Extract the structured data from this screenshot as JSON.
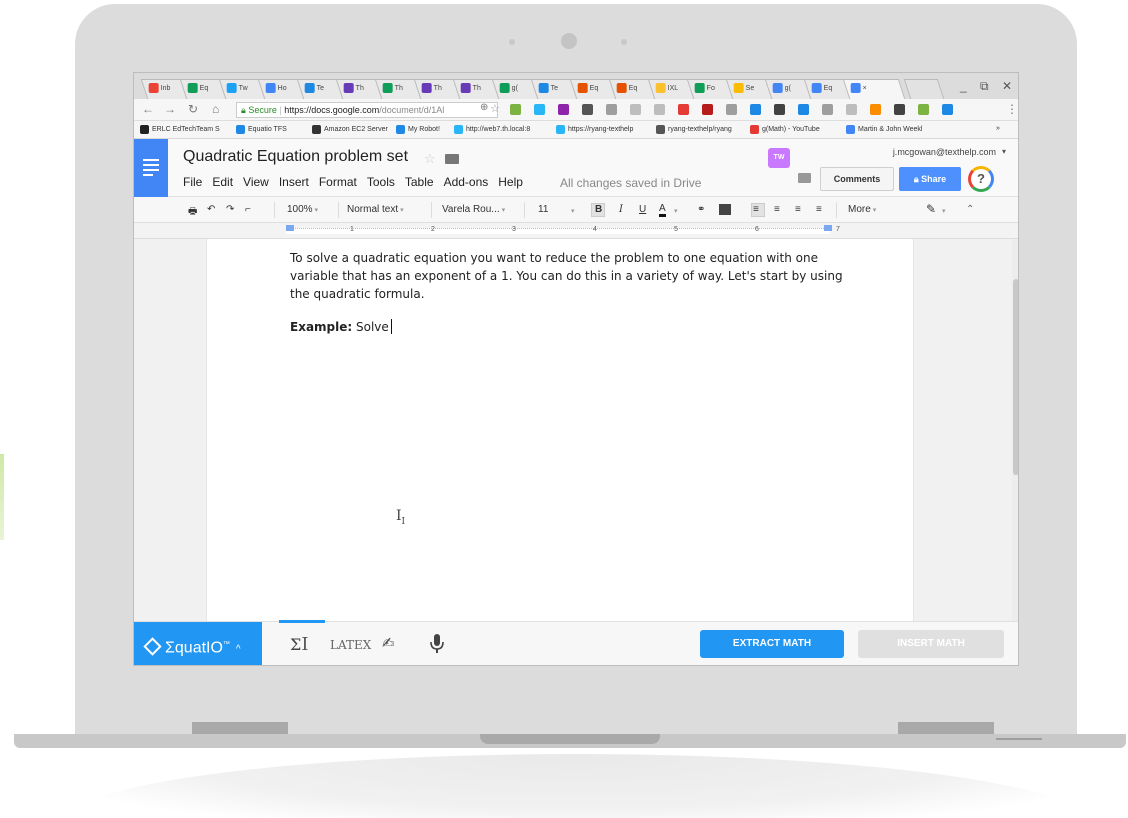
{
  "browser": {
    "tabs": [
      {
        "label": "Inb",
        "icon": "gmail-icon",
        "color": "#ea4335"
      },
      {
        "label": "Eq",
        "icon": "sheets-icon",
        "color": "#0f9d58"
      },
      {
        "label": "Tw",
        "icon": "twitter-icon",
        "color": "#1da1f2"
      },
      {
        "label": "Ho",
        "icon": "search-icon",
        "color": "#4285f4"
      },
      {
        "label": "Te",
        "icon": "tfs-icon",
        "color": "#1e88e5"
      },
      {
        "label": "Th",
        "icon": "forms-icon",
        "color": "#673ab7"
      },
      {
        "label": "Th",
        "icon": "sheets-icon",
        "color": "#0f9d58"
      },
      {
        "label": "Th",
        "icon": "forms-icon",
        "color": "#673ab7"
      },
      {
        "label": "Th",
        "icon": "forms-icon",
        "color": "#673ab7"
      },
      {
        "label": "g(",
        "icon": "sheets-icon",
        "color": "#0f9d58"
      },
      {
        "label": "Te",
        "icon": "tfs-icon",
        "color": "#1e88e5"
      },
      {
        "label": "Eq",
        "icon": "equatio-icon",
        "color": "#e65100"
      },
      {
        "label": "Eq",
        "icon": "equatio-icon",
        "color": "#e65100"
      },
      {
        "label": "IXL",
        "icon": "ixl-icon",
        "color": "#fbc02d"
      },
      {
        "label": "Fo",
        "icon": "sheets-icon",
        "color": "#0f9d58"
      },
      {
        "label": "Se",
        "icon": "drive-icon",
        "color": "#fbbc05"
      },
      {
        "label": "g(",
        "icon": "docs-icon",
        "color": "#4285f4"
      },
      {
        "label": "Eq",
        "icon": "docs-icon",
        "color": "#4285f4"
      },
      {
        "label": "×",
        "icon": "docs-icon",
        "color": "#4285f4"
      }
    ],
    "url_secure": "Secure",
    "url_host": "https://docs.google.com",
    "url_path": "/document/d/1Al",
    "bookmarks": [
      {
        "label": "ERLC EdTechTeam S",
        "color": "#222222"
      },
      {
        "label": "Equatio TFS",
        "color": "#1e88e5"
      },
      {
        "label": "Amazon EC2 Server",
        "color": "#333333"
      },
      {
        "label": "My Robot!",
        "color": "#1e88e5"
      },
      {
        "label": "http://web7.th.local:8",
        "color": "#29b6f6"
      },
      {
        "label": "https://ryang-texthelp",
        "color": "#29b6f6"
      },
      {
        "label": "ryang-texthelp/ryang",
        "color": "#555555"
      },
      {
        "label": "g(Math) - YouTube",
        "color": "#e53935"
      },
      {
        "label": "Martin & John Weekl",
        "color": "#4285f4"
      },
      {
        "label": "»",
        "color": "#ffffff"
      }
    ]
  },
  "docs": {
    "title": "Quadratic Equation problem set",
    "menu": [
      "File",
      "Edit",
      "View",
      "Insert",
      "Format",
      "Tools",
      "Table",
      "Add-ons",
      "Help"
    ],
    "saved_status": "All changes saved in Drive",
    "user_email": "j.mcgowan@texthelp.com",
    "comments_label": "Comments",
    "share_label": "Share",
    "extension_badge": "TW",
    "toolbar": {
      "zoom": "100%",
      "style": "Normal text",
      "font": "Varela Rou...",
      "size": "11",
      "bold": "B",
      "italic": "I",
      "underline": "U",
      "text_color": "A",
      "more": "More"
    },
    "ruler_numbers": [
      "1",
      "2",
      "3",
      "4",
      "5",
      "6",
      "7"
    ],
    "body_paragraph": "To solve a quadratic equation you want to reduce the problem to one equation with one variable that has an exponent of a 1. You can do this in a variety of way. Let's start by using the quadratic formula.",
    "example_label": "Example:",
    "example_text": " Solve"
  },
  "equatio": {
    "logo_text": "ΣquatIO",
    "logo_tm": "™",
    "logo_caret": "^",
    "latex_label": "LATEX",
    "extract_label": "EXTRACT MATH",
    "insert_label": "INSERT MATH",
    "brand_color": "#2196f3"
  }
}
